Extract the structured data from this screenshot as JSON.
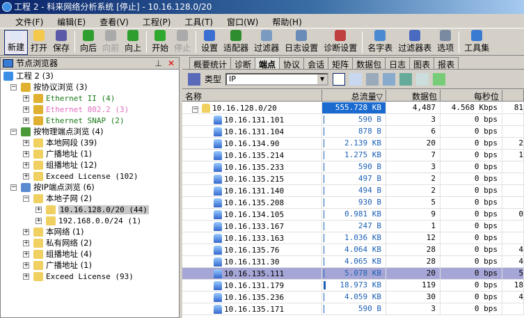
{
  "window": {
    "title": "工程 2 - 科来网络分析系统 [停止] - 10.16.128.0/20"
  },
  "menu": [
    "文件(F)",
    "编辑(E)",
    "查看(V)",
    "工程(P)",
    "工具(T)",
    "窗口(W)",
    "帮助(H)"
  ],
  "toolbar": [
    {
      "label": "新建",
      "state": "active",
      "color": "#dfe6f5"
    },
    {
      "label": "打开",
      "color": "#f4c84a"
    },
    {
      "label": "保存",
      "color": "#5a5aa8"
    },
    {
      "sep": true
    },
    {
      "label": "向后",
      "color": "#2e9e2e"
    },
    {
      "label": "向前",
      "state": "disabled",
      "color": "#aaaaaa"
    },
    {
      "label": "向上",
      "color": "#2e9e2e"
    },
    {
      "sep": true
    },
    {
      "label": "开始",
      "color": "#2ea82e"
    },
    {
      "label": "停止",
      "state": "disabled",
      "color": "#aaaaaa"
    },
    {
      "sep": true
    },
    {
      "label": "设置",
      "color": "#3a6ed0"
    },
    {
      "label": "适配器",
      "color": "#2e8e2e"
    },
    {
      "label": "过滤器",
      "color": "#7b9bc0"
    },
    {
      "label": "日志设置",
      "color": "#6a8ab8"
    },
    {
      "label": "诊断设置",
      "color": "#c04040"
    },
    {
      "sep": true
    },
    {
      "label": "名字表",
      "color": "#4a8ad0"
    },
    {
      "label": "过滤器表",
      "color": "#4a6ac0"
    },
    {
      "label": "选项",
      "color": "#7a8aa0"
    },
    {
      "sep": true
    },
    {
      "label": "工具集",
      "color": "#3a7ad0"
    }
  ],
  "node_browser": {
    "title": "节点浏览器",
    "tree": [
      {
        "label": "工程 2 (3)",
        "level": 0,
        "icon": "project",
        "exp": ""
      },
      {
        "label": "按协议浏览 (3)",
        "level": 1,
        "icon": "protocol",
        "exp": "-"
      },
      {
        "label": "Ethernet II (4)",
        "level": 2,
        "icon": "protocol",
        "exp": "+",
        "color": "#1a7a1a",
        "mono": true
      },
      {
        "label": "Ethernet 802.2 (3)",
        "level": 2,
        "icon": "protocol",
        "exp": "+",
        "color": "#e070c0",
        "mono": true
      },
      {
        "label": "Ethernet SNAP (2)",
        "level": 2,
        "icon": "protocol",
        "exp": "+",
        "color": "#1a7a1a",
        "mono": true
      },
      {
        "label": "按物理端点浏览 (4)",
        "level": 1,
        "icon": "physical",
        "exp": "-"
      },
      {
        "label": "本地网段 (39)",
        "level": 2,
        "icon": "folder",
        "exp": "+"
      },
      {
        "label": "广播地址 (1)",
        "level": 2,
        "icon": "folder",
        "exp": "+"
      },
      {
        "label": "组播地址 (12)",
        "level": 2,
        "icon": "folder",
        "exp": "+"
      },
      {
        "label": "Exceed License (102)",
        "level": 2,
        "icon": "folder",
        "exp": "+",
        "mono": true
      },
      {
        "label": "按IP端点浏览 (6)",
        "level": 1,
        "icon": "ip",
        "exp": "-"
      },
      {
        "label": "本地子网 (2)",
        "level": 2,
        "icon": "folder",
        "exp": "-"
      },
      {
        "label": "10.16.128.0/20 (44)",
        "level": 3,
        "icon": "folder",
        "exp": "+",
        "selected": true,
        "mono": true
      },
      {
        "label": "192.168.0.0/24 (1)",
        "level": 3,
        "icon": "folder",
        "exp": "+",
        "mono": true
      },
      {
        "label": "本网络 (1)",
        "level": 2,
        "icon": "folder",
        "exp": "+"
      },
      {
        "label": "私有网络 (2)",
        "level": 2,
        "icon": "folder",
        "exp": "+"
      },
      {
        "label": "组播地址 (4)",
        "level": 2,
        "icon": "folder",
        "exp": "+"
      },
      {
        "label": "广播地址 (1)",
        "level": 2,
        "icon": "folder",
        "exp": "+"
      },
      {
        "label": "Exceed License (93)",
        "level": 2,
        "icon": "folder",
        "exp": "+",
        "mono": true
      }
    ]
  },
  "tabs": [
    "概要统计",
    "诊断",
    "端点",
    "协议",
    "会话",
    "矩阵",
    "数据包",
    "日志",
    "图表",
    "报表"
  ],
  "selected_tab": "端点",
  "type_label": "类型",
  "type_value": "IP",
  "columns": [
    "名称",
    "总流量▽",
    "数据包",
    "每秒位",
    ""
  ],
  "parent_row": {
    "name": "10.16.128.0/20",
    "total": "555.728 KB",
    "packets": "4,487",
    "bps": "4.568 Kbps",
    "extra": "81"
  },
  "rows": [
    {
      "name": "10.16.131.101",
      "total": "590  B",
      "packets": "3",
      "bps": "0 bps",
      "extra": ""
    },
    {
      "name": "10.16.131.104",
      "total": "878  B",
      "packets": "6",
      "bps": "0 bps",
      "extra": ""
    },
    {
      "name": "10.16.134.90",
      "total": "2.139 KB",
      "packets": "20",
      "bps": "0 bps",
      "extra": "2"
    },
    {
      "name": "10.16.135.214",
      "total": "1.275 KB",
      "packets": "7",
      "bps": "0 bps",
      "extra": "1"
    },
    {
      "name": "10.16.135.233",
      "total": "590  B",
      "packets": "3",
      "bps": "0 bps",
      "extra": ""
    },
    {
      "name": "10.16.135.215",
      "total": "497  B",
      "packets": "2",
      "bps": "0 bps",
      "extra": ""
    },
    {
      "name": "10.16.131.140",
      "total": "494  B",
      "packets": "2",
      "bps": "0 bps",
      "extra": ""
    },
    {
      "name": "10.16.135.208",
      "total": "930  B",
      "packets": "5",
      "bps": "0 bps",
      "extra": ""
    },
    {
      "name": "10.16.134.105",
      "total": "0.981 KB",
      "packets": "9",
      "bps": "0 bps",
      "extra": "0"
    },
    {
      "name": "10.16.133.167",
      "total": "247  B",
      "packets": "1",
      "bps": "0 bps",
      "extra": ""
    },
    {
      "name": "10.16.133.163",
      "total": "1.036 KB",
      "packets": "12",
      "bps": "0 bps",
      "extra": ""
    },
    {
      "name": "10.16.135.76",
      "total": "4.064 KB",
      "packets": "28",
      "bps": "0 bps",
      "extra": "4"
    },
    {
      "name": "10.16.131.30",
      "total": "4.065 KB",
      "packets": "28",
      "bps": "0 bps",
      "extra": "4"
    },
    {
      "name": "10.16.135.111",
      "total": "5.078 KB",
      "packets": "20",
      "bps": "0 bps",
      "extra": "5",
      "selected": true
    },
    {
      "name": "10.16.131.179",
      "total": "18.973 KB",
      "packets": "119",
      "bps": "0 bps",
      "extra": "18"
    },
    {
      "name": "10.16.135.236",
      "total": "4.059 KB",
      "packets": "30",
      "bps": "0 bps",
      "extra": "4"
    },
    {
      "name": "10.16.135.171",
      "total": "590  B",
      "packets": "3",
      "bps": "0 bps",
      "extra": ""
    }
  ]
}
